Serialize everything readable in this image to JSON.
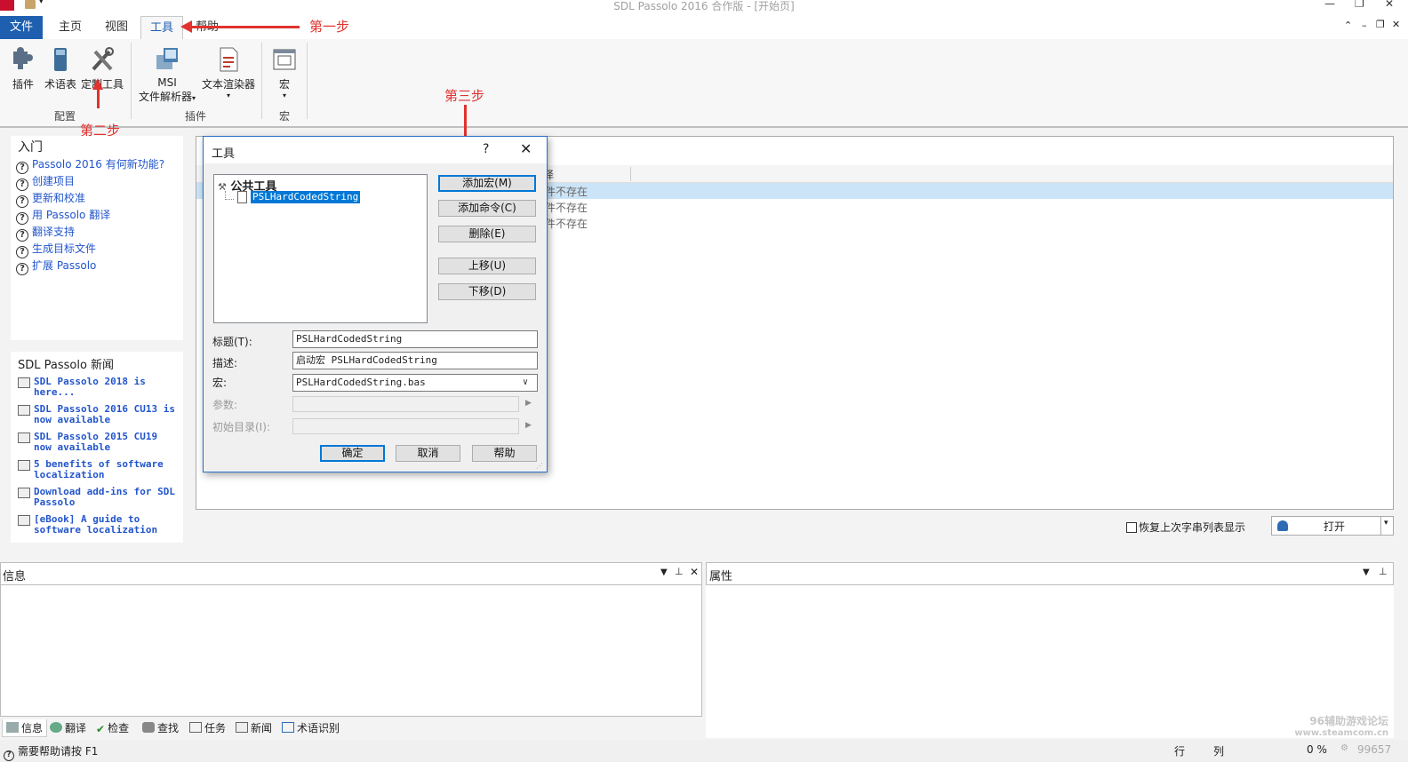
{
  "window": {
    "title": "SDL Passolo 2016 合作版 - [开始页]"
  },
  "ribbon_tabs": [
    {
      "label": "文件"
    },
    {
      "label": "主页"
    },
    {
      "label": "视图"
    },
    {
      "label": "工具"
    },
    {
      "label": "帮助"
    }
  ],
  "ribbon": {
    "groups": [
      {
        "label": "配置",
        "items": [
          {
            "label": "插件"
          },
          {
            "label": "术语表"
          },
          {
            "label": "定制工具"
          }
        ]
      },
      {
        "label": "插件",
        "items": [
          {
            "label": "MSI",
            "label2": "文件解析器"
          },
          {
            "label": "文本渲染器"
          }
        ]
      },
      {
        "label": "宏",
        "items": [
          {
            "label": "宏"
          }
        ]
      }
    ]
  },
  "annotations": {
    "step1": "第一步",
    "step2": "第二步",
    "step3": "第三步"
  },
  "getting_started": {
    "title": "入门",
    "links": [
      "Passolo 2016 有何新功能?",
      "创建项目",
      "更新和校准",
      "用 Passolo 翻译",
      "翻译支持",
      "生成目标文件",
      "扩展 Passolo"
    ]
  },
  "news": {
    "title": "SDL Passolo 新闻",
    "items": [
      {
        "l1": "SDL Passolo 2018 is",
        "l2": "here..."
      },
      {
        "l1": "SDL Passolo 2016 CU13 is",
        "l2": "now available"
      },
      {
        "l1": "SDL Passolo 2015 CU19",
        "l2": "now available"
      },
      {
        "l1": "5 benefits of software",
        "l2": "localization"
      },
      {
        "l1": "Download add-ins for SDL",
        "l2": "Passolo"
      },
      {
        "l1": "[eBook] A guide to",
        "l2": "software localization"
      }
    ]
  },
  "main_list": {
    "col_fragment": "译",
    "rows": [
      "件不存在",
      "件不存在",
      "件不存在"
    ],
    "restore_checkbox": "恢复上次字串列表显示",
    "open_button": "打开"
  },
  "dialog": {
    "title": "工具",
    "help": "?",
    "close": "✕",
    "tree_root": "公共工具",
    "tree_child": "PSLHardCodedString",
    "buttons": {
      "add_macro": "添加宏(M)",
      "add_command": "添加命令(C)",
      "delete": "删除(E)",
      "move_up": "上移(U)",
      "move_down": "下移(D)",
      "ok": "确定",
      "cancel": "取消",
      "help": "帮助"
    },
    "fields": {
      "title_label": "标题(T):",
      "title_value": "PSLHardCodedString",
      "desc_label": "描述:",
      "desc_value": "启动宏 PSLHardCodedString",
      "macro_label": "宏:",
      "macro_value": "PSLHardCodedString.bas",
      "params_label": "参数:",
      "initdir_label": "初始目录(I):"
    }
  },
  "bottom": {
    "info_title": "信息",
    "props_title": "属性",
    "tabs": [
      "信息",
      "翻译",
      "检查",
      "查找",
      "任务",
      "新闻",
      "术语识别"
    ]
  },
  "statusbar": {
    "help_text": "需要帮助请按 F1",
    "row_label": "行",
    "col_label": "列",
    "percent": "0 %",
    "count": "99657"
  },
  "watermark": {
    "line1": "96辅助游戏论坛",
    "line2": "www.steamcom.cn"
  },
  "colors": {
    "accent": "#1f5fb0",
    "annotation": "#e0322f",
    "link": "#2255cc",
    "selection": "#0078d7"
  }
}
